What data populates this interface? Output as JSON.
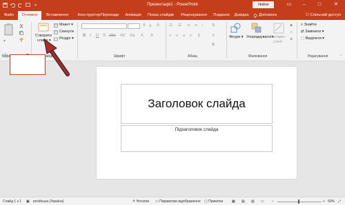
{
  "app": {
    "doc_title": "Презентація1  -  PowerPoint",
    "signin": "Увійти",
    "accent": "#c43e1c"
  },
  "tabs": [
    "Файл",
    "Основне",
    "Вставлення",
    "Конструктор",
    "Переходи",
    "Анімація",
    "Показ слайдів",
    "Рецензування",
    "Подання",
    "Довідка"
  ],
  "help_search": "Допомога",
  "shared_access": "Спільний доступ",
  "ribbon": {
    "groups": {
      "clipboard": "Буфер обміну",
      "slides": "Слайди",
      "font": "Шрифт",
      "paragraph": "Абзац",
      "drawing": "Малювання",
      "editing": "Редагування"
    },
    "create_slide_line1": "Створити",
    "create_slide_line2": "слайд",
    "layout": "Макет",
    "reset": "Скинути",
    "sections": "Розділ",
    "shapes": "Фігури",
    "arrange": "Упорядкувати",
    "quick_styles_line1": "Експрес-",
    "quick_styles_line2": "стилі",
    "find": "Знайти",
    "replace": "Замінити",
    "select": "Виділити"
  },
  "slide": {
    "number": "1",
    "title": "Заголовок слайда",
    "subtitle": "Підзаголовок слайда"
  },
  "status": {
    "slide_count": "Слайд 1 з 1",
    "language": "російська (Україна)",
    "notes": "Нотатки",
    "display_settings": "Параметри відображення",
    "comments": "Примітки",
    "zoom": "50%"
  }
}
